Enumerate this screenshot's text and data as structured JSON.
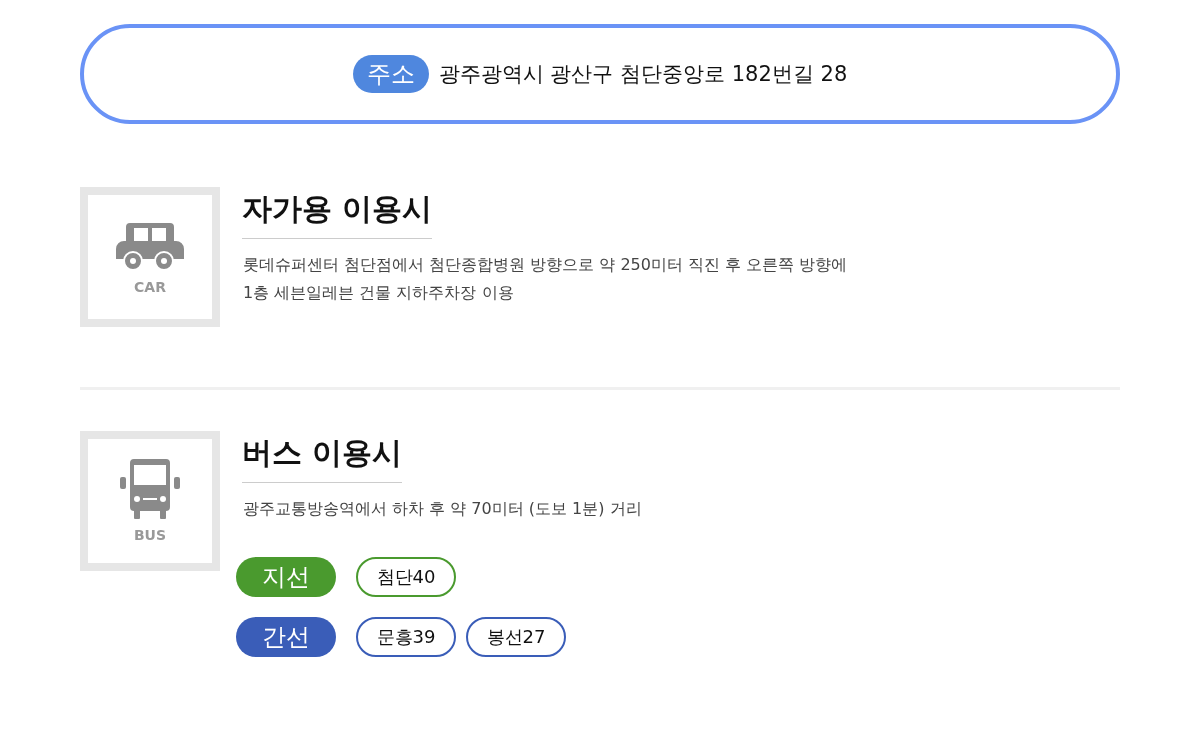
{
  "address": {
    "label": "주소",
    "text": "광주광역시 광산구 첨단중앙로 182번길 28"
  },
  "sections": [
    {
      "kind": "car",
      "icon_label": "CAR",
      "title": "자가용 이용시",
      "description": "롯데슈퍼센터 첨단점에서 첨단종합병원 방향으로 약 250미터 직진 후 오른쪽 방향에\n1층 세븐일레븐 건물 지하주차장 이용"
    },
    {
      "kind": "bus",
      "icon_label": "BUS",
      "title": "버스 이용시",
      "description": "광주교통방송역에서 하차 후 약 70미터 (도보 1분) 거리",
      "route_groups": [
        {
          "label": "지선",
          "color": "#4a9a2e",
          "routes": [
            "첨단40"
          ]
        },
        {
          "label": "간선",
          "color": "#3a5db8",
          "routes": [
            "문흥39",
            "봉선27"
          ]
        }
      ]
    }
  ]
}
